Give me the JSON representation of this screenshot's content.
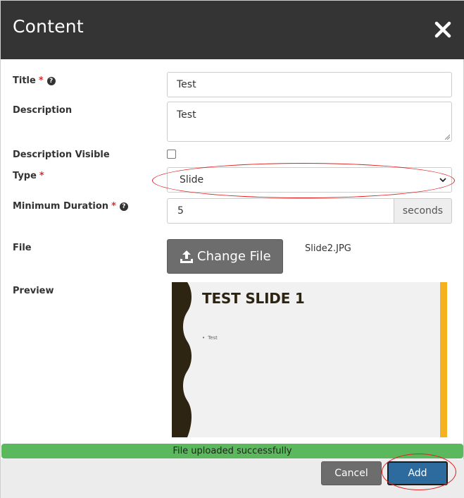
{
  "modal": {
    "title": "Content"
  },
  "form": {
    "title": {
      "label": "Title",
      "required": "*",
      "value": "Test"
    },
    "description": {
      "label": "Description",
      "value": "Test"
    },
    "description_visible": {
      "label": "Description Visible",
      "checked": false
    },
    "type": {
      "label": "Type",
      "required": "*",
      "selected": "Slide"
    },
    "min_duration": {
      "label": "Minimum Duration",
      "required": "*",
      "value": "5",
      "unit": "seconds"
    },
    "file": {
      "label": "File",
      "button_label": "Change File",
      "filename": "Slide2.JPG"
    },
    "preview": {
      "label": "Preview",
      "slide_title": "TEST SLIDE 1",
      "bullet": "Test"
    }
  },
  "status": {
    "message": "File uploaded successfully"
  },
  "footer": {
    "cancel_label": "Cancel",
    "add_label": "Add"
  },
  "icons": {
    "close": "close-icon",
    "help": "question-circle-icon",
    "upload": "upload-icon",
    "select_arrow": "chevron-down-icon"
  },
  "colors": {
    "header_bg": "#343434",
    "success": "#5cb85c",
    "primary": "#2d6a9e",
    "secondary": "#6d6d6d",
    "required": "#d9302c",
    "annotation": "#e0201e",
    "slide_accent": "#f5b21f",
    "slide_dark": "#2e2412"
  }
}
